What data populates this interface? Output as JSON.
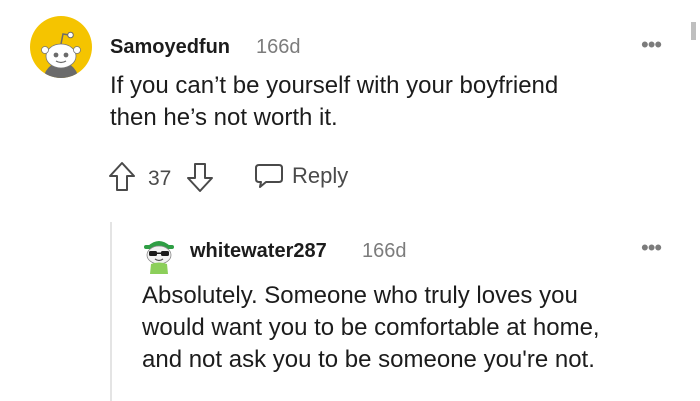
{
  "comment": {
    "author": "Samoyedfun",
    "age": "166d",
    "text_line1": "If you can’t be yourself with your boyfriend",
    "text_line2": "then he’s not worth it.",
    "votes": "37",
    "reply_label": "Reply",
    "more_label": "•••"
  },
  "reply": {
    "author": "whitewater287",
    "age": "166d",
    "text_line1": "Absolutely. Someone who truly loves you",
    "text_line2": "would want you to be comfortable at home,",
    "text_line3": "and not ask you to be someone you're not.",
    "more_label": "•••"
  },
  "colors": {
    "avatar_bg": "#f5c400",
    "text": "#1c1c1c",
    "muted": "#7c7c7c"
  }
}
